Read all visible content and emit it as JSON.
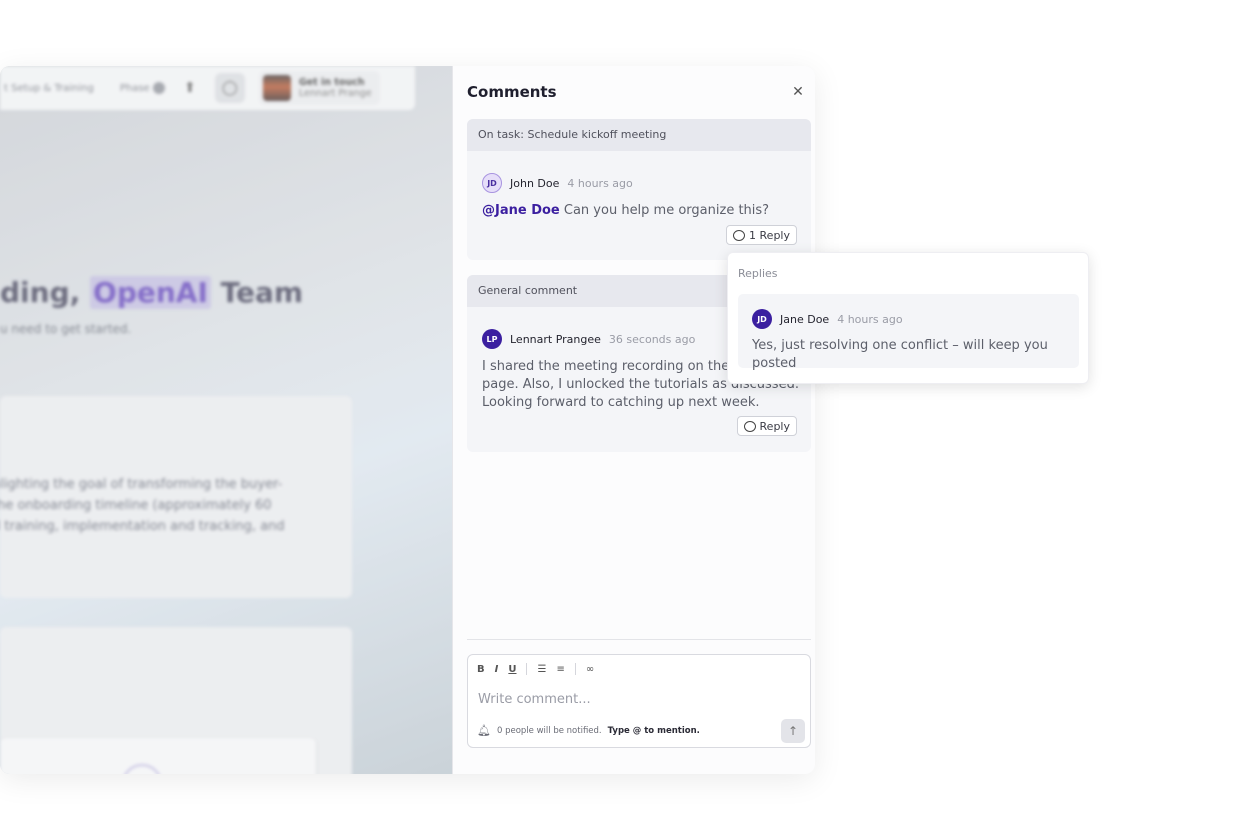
{
  "background_app": {
    "topbar": {
      "breadcrumb": "t Setup & Training",
      "phase_label": "Phase",
      "contact_title": "Get in touch",
      "contact_name": "Lennart Prange"
    },
    "hero_title_prefix": "ding,",
    "hero_title_highlight": "OpenAI",
    "hero_title_suffix": "Team",
    "hero_subtitle": "u need to get started.",
    "card_text_lines": [
      "hlighting the goal of transforming the buyer-",
      "the onboarding timeline (approximately 60",
      "d training, implementation and tracking, and"
    ]
  },
  "comments_panel": {
    "title": "Comments",
    "close_icon": "close-icon",
    "threads": [
      {
        "header": "On task: Schedule kickoff meeting",
        "author_initials": "JD",
        "author": "John Doe",
        "time": "4 hours ago",
        "mention": "@Jane Doe",
        "text": "Can you help me organize this?",
        "reply_button": "1 Reply"
      },
      {
        "header": "General comment",
        "author_initials": "LP",
        "author": "Lennart Prangee",
        "time": "36 seconds ago",
        "text_lines": [
          "I shared the meeting recording on the reso",
          "page. Also, I unlocked the tutorials as discussed.",
          "Looking forward to catching up next week."
        ],
        "reply_button": "Reply"
      }
    ],
    "editor": {
      "toolbar": [
        "B",
        "I",
        "U",
        "bulleted-list-icon",
        "numbered-list-icon",
        "link-icon"
      ],
      "placeholder": "Write comment...",
      "notify_text": "0 people will be notified.",
      "notify_hint": "Type @ to mention.",
      "send_icon": "arrow-up-icon"
    }
  },
  "replies_popover": {
    "label": "Replies",
    "reply": {
      "author_initials": "JD",
      "author": "Jane Doe",
      "time": "4 hours ago",
      "text": "Yes, just resolving one conflict – will keep you posted"
    }
  },
  "colors": {
    "accent": "#3b1fa0",
    "highlight": "#5d3fb7"
  }
}
